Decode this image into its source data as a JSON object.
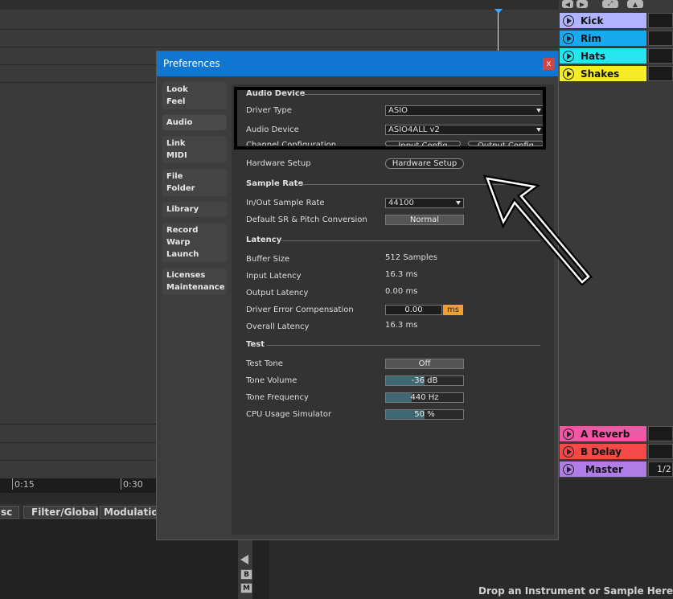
{
  "timeline": {
    "marks": [
      "0:15",
      "0:30"
    ]
  },
  "device_tabs": [
    "sc",
    "Filter/Global",
    "Modulatio"
  ],
  "drop_text": "Drop an Instrument or Sample Here",
  "side_buttons": [
    "B",
    "M"
  ],
  "tracks": {
    "clips": [
      {
        "name": "Kick",
        "color": "#b0b4ff"
      },
      {
        "name": "Rim",
        "color": "#19a9f1"
      },
      {
        "name": "Hats",
        "color": "#27e5f0"
      },
      {
        "name": "Shakes",
        "color": "#f5ec29"
      }
    ],
    "returns": [
      {
        "name": "A Reverb",
        "color": "#f057a5"
      },
      {
        "name": "B Delay",
        "color": "#f54949"
      },
      {
        "name": "Master",
        "color": "#b07ce6"
      }
    ],
    "master_value": "1/2"
  },
  "dialog": {
    "title": "Preferences",
    "close": "x",
    "nav": [
      [
        "Look",
        "Feel"
      ],
      [
        "Audio"
      ],
      [
        "Link",
        "MIDI"
      ],
      [
        "File",
        "Folder"
      ],
      [
        "Library"
      ],
      [
        "Record",
        "Warp",
        "Launch"
      ],
      [
        "Licenses",
        "Maintenance"
      ]
    ],
    "audio_device": {
      "heading": "Audio Device",
      "driver_type_label": "Driver Type",
      "driver_type_value": "ASIO",
      "audio_device_label": "Audio Device",
      "audio_device_value": "ASIO4ALL v2",
      "channel_config_label": "Channel Configuration",
      "input_config": "Input Config",
      "output_config": "Output Config",
      "hardware_setup_label": "Hardware Setup",
      "hardware_setup_button": "Hardware Setup"
    },
    "sample_rate": {
      "heading": "Sample Rate",
      "inout_label": "In/Out Sample Rate",
      "inout_value": "44100",
      "default_sr_label": "Default SR & Pitch Conversion",
      "default_sr_value": "Normal"
    },
    "latency": {
      "heading": "Latency",
      "buffer_label": "Buffer Size",
      "buffer_value": "512 Samples",
      "input_label": "Input Latency",
      "input_value": "16.3 ms",
      "output_label": "Output Latency",
      "output_value": "0.00 ms",
      "driver_comp_label": "Driver Error Compensation",
      "driver_comp_value": "0.00",
      "driver_comp_unit": "ms",
      "overall_label": "Overall Latency",
      "overall_value": "16.3 ms"
    },
    "test": {
      "heading": "Test",
      "tone_label": "Test Tone",
      "tone_value": "Off",
      "volume_label": "Tone Volume",
      "volume_value": "-36 dB",
      "volume_level": 0.5,
      "freq_label": "Tone Frequency",
      "freq_value": "440 Hz",
      "freq_level": 0.33,
      "cpu_label": "CPU Usage Simulator",
      "cpu_value": "50 %",
      "cpu_level": 0.5
    }
  }
}
